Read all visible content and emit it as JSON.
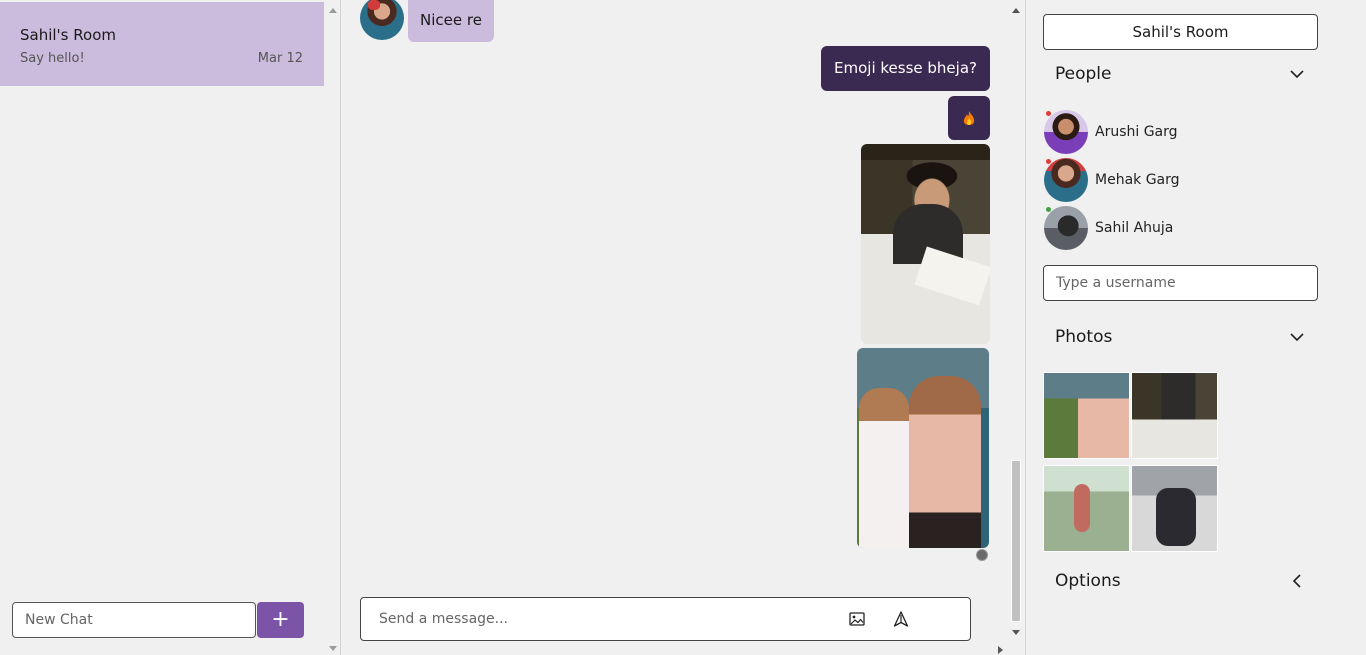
{
  "sidebar": {
    "chat": {
      "title": "Sahil's Room",
      "preview": "Say hello!",
      "date": "Mar 12"
    },
    "new_chat_placeholder": "New Chat",
    "add_label": "+"
  },
  "messages": {
    "incoming_text": "Nicee re",
    "outgoing_text": "Emoji kesse bheja?",
    "emoji_icon": "fire-emoji"
  },
  "composer": {
    "placeholder": "Send a message...",
    "image_icon": "image-icon",
    "send_icon": "send-icon"
  },
  "details": {
    "room_name": "Sahil's Room",
    "people_header": "People",
    "people": [
      {
        "name": "Arushi Garg",
        "status_color": "#e53935"
      },
      {
        "name": "Mehak Garg",
        "status_color": "#e53935"
      },
      {
        "name": "Sahil Ahuja",
        "status_color": "#43a047"
      }
    ],
    "username_placeholder": "Type a username",
    "photos_header": "Photos",
    "options_header": "Options"
  },
  "colors": {
    "accent": "#7b54a8",
    "incoming_bubble": "#cbbcde",
    "outgoing_bubble": "#3a2a52",
    "selected_chat": "#cbbcde"
  }
}
